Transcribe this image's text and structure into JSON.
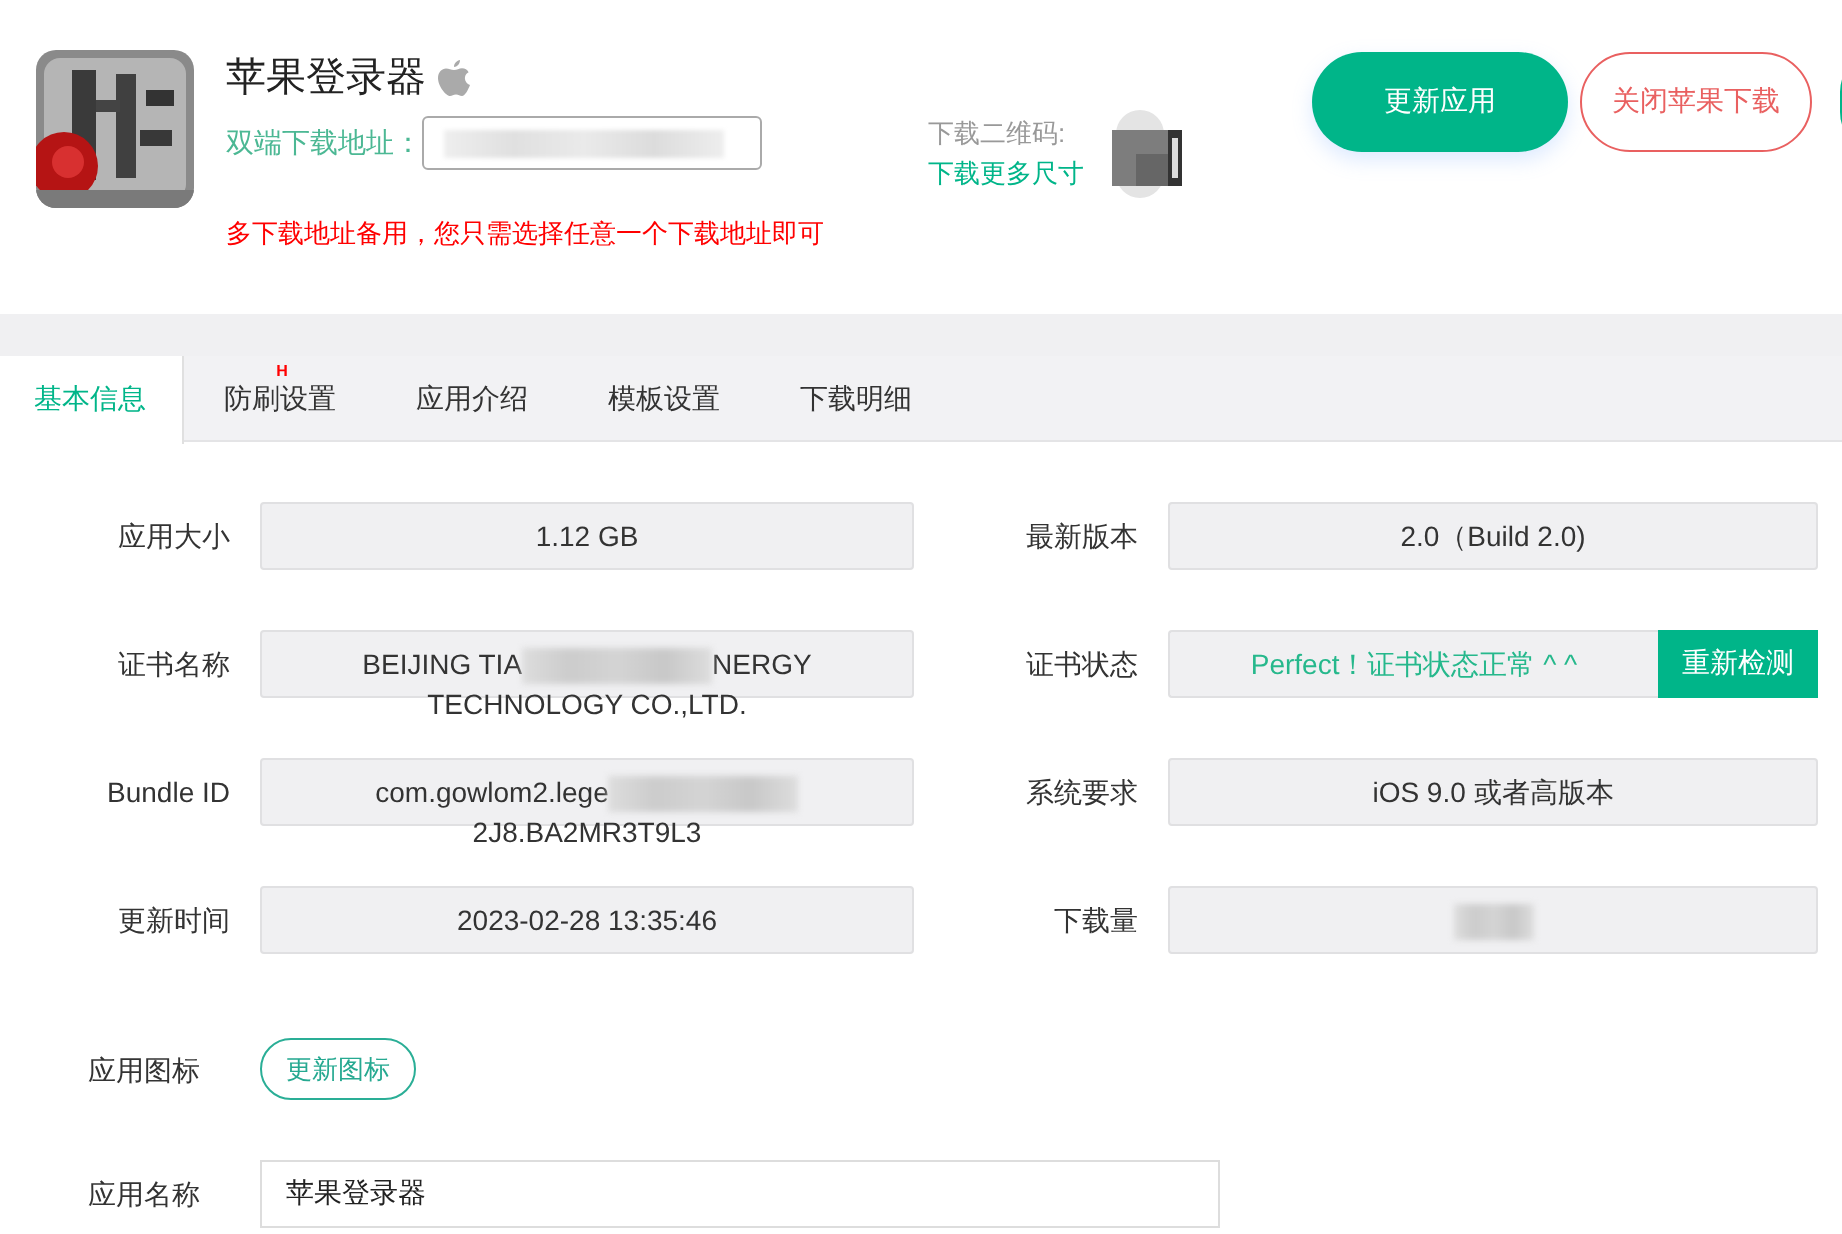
{
  "app": {
    "title": "苹果登录器",
    "address_label": "双端下载地址：",
    "address_redacted": true,
    "notice": "多下载地址备用，您只需选择任意一个下载地址即可",
    "qr_label": "下载二维码:",
    "qr_link": "下载更多尺寸"
  },
  "buttons": [
    {
      "label": "更新应用",
      "kind": "primary"
    },
    {
      "label": "关闭苹果下载",
      "kind": "danger"
    },
    {
      "kind": "cut"
    }
  ],
  "tabs": [
    {
      "label": "基本信息",
      "selected": true
    },
    {
      "label": "防刷设置",
      "selected": false,
      "badge": "H"
    },
    {
      "label": "应用介绍",
      "selected": false
    },
    {
      "label": "模板设置",
      "selected": false
    },
    {
      "label": "下载明细",
      "selected": false
    }
  ],
  "fields": [
    {
      "label": "应用大小",
      "parts": [
        "1.12 GB"
      ],
      "redacted": false
    },
    {
      "label": "最新版本",
      "parts": [
        "2.0（Build 2.0)"
      ],
      "redacted": false
    },
    {
      "label": "证书名称",
      "parts": [
        "BEIJING TIA",
        "NERGY TECHNOLOGY CO.,LTD."
      ],
      "redacted": true
    },
    {
      "label": "证书状态",
      "kind": "status",
      "parts": [
        "Perfect！证书状态正常 ^ ^"
      ],
      "redacted": false,
      "button": "重新检测"
    },
    {
      "label": "Bundle ID",
      "parts": [
        "com.gowlom2.lege",
        "2J8.BA2MR3T9L3"
      ],
      "redacted": true
    },
    {
      "label": "系统要求",
      "parts": [
        "iOS 9.0 或者高版本"
      ],
      "redacted": false
    },
    {
      "label": "更新时间",
      "parts": [
        "2023-02-28 13:35:46"
      ],
      "redacted": false
    },
    {
      "label": "下载量",
      "redacted": true
    }
  ],
  "icon_row": {
    "label": "应用图标",
    "button": "更新图标"
  },
  "name_row": {
    "label": "应用名称",
    "value": "苹果登录器"
  }
}
